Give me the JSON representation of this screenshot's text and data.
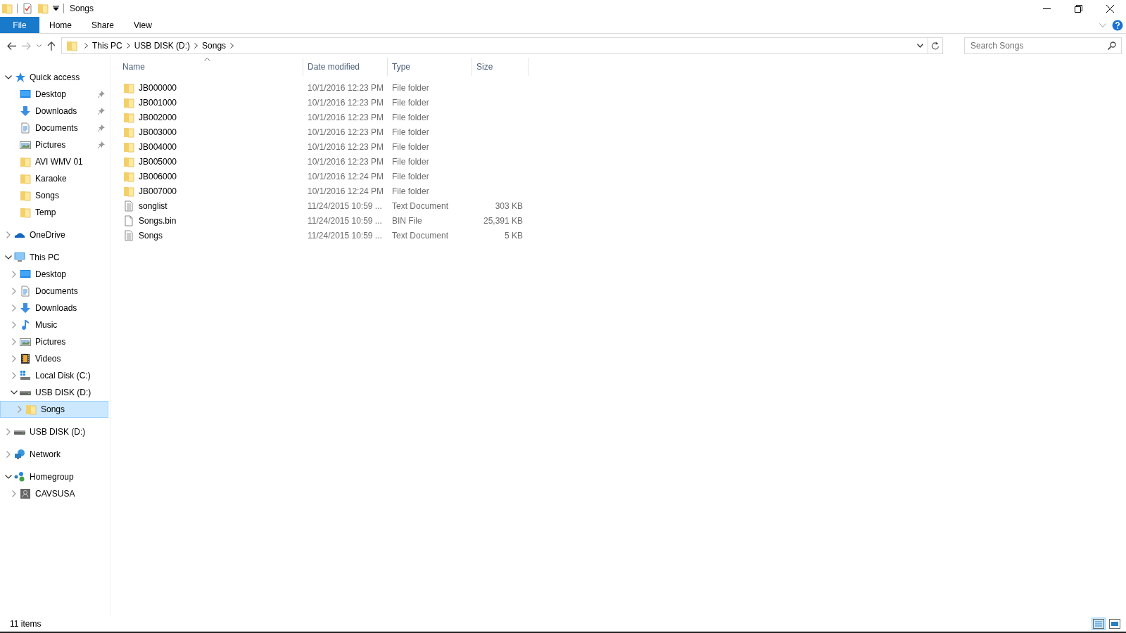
{
  "window": {
    "title": "Songs"
  },
  "ribbon": {
    "file_button": "File",
    "tabs": [
      "Home",
      "Share",
      "View"
    ]
  },
  "address_bar": {
    "breadcrumbs": [
      "This PC",
      "USB DISK (D:)",
      "Songs"
    ]
  },
  "search": {
    "placeholder": "Search Songs"
  },
  "sidebar": {
    "groups": [
      {
        "label": "Quick access",
        "kind": "star",
        "expanded": true,
        "selected": false,
        "children": [
          {
            "label": "Desktop",
            "kind": "desktop",
            "pinned": true,
            "selected": false
          },
          {
            "label": "Downloads",
            "kind": "download",
            "pinned": true,
            "selected": false
          },
          {
            "label": "Documents",
            "kind": "document",
            "pinned": true,
            "selected": false
          },
          {
            "label": "Pictures",
            "kind": "picture",
            "pinned": true,
            "selected": false
          },
          {
            "label": "AVI WMV 01",
            "kind": "folder",
            "pinned": false,
            "selected": false
          },
          {
            "label": "Karaoke",
            "kind": "folder",
            "pinned": false,
            "selected": false
          },
          {
            "label": "Songs",
            "kind": "folder",
            "pinned": false,
            "selected": false
          },
          {
            "label": "Temp",
            "kind": "folder",
            "pinned": false,
            "selected": false
          }
        ]
      },
      {
        "label": "OneDrive",
        "kind": "cloud",
        "expanded": false,
        "selected": false
      },
      {
        "label": "This PC",
        "kind": "computer",
        "expanded": true,
        "selected": false,
        "children": [
          {
            "label": "Desktop",
            "kind": "desktop",
            "expanded": false,
            "selected": false
          },
          {
            "label": "Documents",
            "kind": "document",
            "expanded": false,
            "selected": false
          },
          {
            "label": "Downloads",
            "kind": "download",
            "expanded": false,
            "selected": false
          },
          {
            "label": "Music",
            "kind": "music",
            "expanded": false,
            "selected": false
          },
          {
            "label": "Pictures",
            "kind": "picture",
            "expanded": false,
            "selected": false
          },
          {
            "label": "Videos",
            "kind": "video",
            "expanded": false,
            "selected": false
          },
          {
            "label": "Local Disk (C:)",
            "kind": "systemdrive",
            "expanded": false,
            "selected": false
          },
          {
            "label": "USB DISK (D:)",
            "kind": "drive",
            "expanded": true,
            "selected": false,
            "children": [
              {
                "label": "Songs",
                "kind": "folder",
                "expanded": false,
                "selected": true
              }
            ]
          }
        ]
      },
      {
        "label": "USB DISK (D:)",
        "kind": "drive",
        "expanded": false,
        "selected": false
      },
      {
        "label": "Network",
        "kind": "network",
        "expanded": false,
        "selected": false
      },
      {
        "label": "Homegroup",
        "kind": "homegroup",
        "expanded": true,
        "selected": false,
        "children": [
          {
            "label": "CAVSUSA",
            "kind": "user",
            "expanded": false,
            "selected": false
          }
        ]
      }
    ]
  },
  "file_list": {
    "columns": [
      {
        "label": "Name",
        "sorted": true
      },
      {
        "label": "Date modified",
        "sorted": false
      },
      {
        "label": "Type",
        "sorted": false
      },
      {
        "label": "Size",
        "sorted": false
      }
    ],
    "rows": [
      {
        "name": "JB000000",
        "kind": "folder",
        "date": "10/1/2016 12:23 PM",
        "type": "File folder"
      },
      {
        "name": "JB001000",
        "kind": "folder",
        "date": "10/1/2016 12:23 PM",
        "type": "File folder"
      },
      {
        "name": "JB002000",
        "kind": "folder",
        "date": "10/1/2016 12:23 PM",
        "type": "File folder"
      },
      {
        "name": "JB003000",
        "kind": "folder",
        "date": "10/1/2016 12:23 PM",
        "type": "File folder"
      },
      {
        "name": "JB004000",
        "kind": "folder",
        "date": "10/1/2016 12:23 PM",
        "type": "File folder"
      },
      {
        "name": "JB005000",
        "kind": "folder",
        "date": "10/1/2016 12:23 PM",
        "type": "File folder"
      },
      {
        "name": "JB006000",
        "kind": "folder",
        "date": "10/1/2016 12:24 PM",
        "type": "File folder"
      },
      {
        "name": "JB007000",
        "kind": "folder",
        "date": "10/1/2016 12:24 PM",
        "type": "File folder"
      },
      {
        "name": "songlist",
        "kind": "text",
        "date": "11/24/2015 10:59 ...",
        "type": "Text Document",
        "size": "303 KB"
      },
      {
        "name": "Songs.bin",
        "kind": "file",
        "date": "11/24/2015 10:59 ...",
        "type": "BIN File",
        "size": "25,391 KB"
      },
      {
        "name": "Songs",
        "kind": "text",
        "date": "11/24/2015 10:59 ...",
        "type": "Text Document",
        "size": "5 KB"
      }
    ]
  },
  "status_bar": {
    "item_count": "11 items",
    "view_buttons": [
      {
        "kind": "details",
        "selected": true
      },
      {
        "kind": "tiles",
        "selected": false
      }
    ]
  }
}
